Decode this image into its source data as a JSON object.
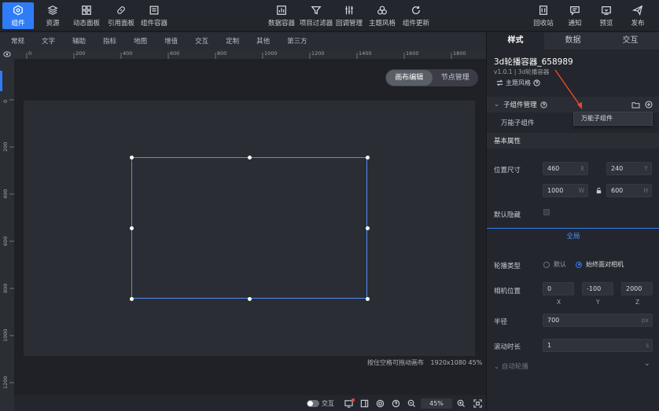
{
  "toolbar": {
    "left": [
      {
        "label": "组件",
        "icon": "component-icon"
      },
      {
        "label": "资源",
        "icon": "layers-icon"
      },
      {
        "label": "动态面板",
        "icon": "panel-icon"
      },
      {
        "label": "引用面板",
        "icon": "link-icon"
      },
      {
        "label": "组件容器",
        "icon": "container-icon"
      }
    ],
    "center": [
      {
        "label": "数据容器",
        "icon": "chart-icon"
      },
      {
        "label": "项目过滤器",
        "icon": "filter-icon"
      },
      {
        "label": "回调管理",
        "icon": "sliders-icon"
      },
      {
        "label": "主题风格",
        "icon": "theme-icon"
      },
      {
        "label": "组件更新",
        "icon": "refresh-icon"
      }
    ],
    "right": [
      {
        "label": "回收站",
        "icon": "trash-icon"
      },
      {
        "label": "通知",
        "icon": "message-icon"
      },
      {
        "label": "预览",
        "icon": "preview-icon"
      },
      {
        "label": "发布",
        "icon": "send-icon"
      }
    ]
  },
  "categories": [
    "常规",
    "文字",
    "辅助",
    "指标",
    "地图",
    "增值",
    "交互",
    "定制",
    "其他",
    "第三方"
  ],
  "ruler": {
    "top": [
      "0",
      "200",
      "400",
      "600",
      "800",
      "1000",
      "1200",
      "1400",
      "1600",
      "1800"
    ],
    "left": [
      "0",
      "200",
      "400",
      "600",
      "800",
      "1000",
      "1200"
    ]
  },
  "canvas": {
    "mode_tabs": [
      "画布编辑",
      "节点管理"
    ],
    "active_mode": "画布编辑",
    "hint": "按住空格可拖动画布",
    "resolution": "1920x1080 45%"
  },
  "bottombar": {
    "interaction_label": "交互",
    "zoom": "45%"
  },
  "panel": {
    "tabs": [
      "样式",
      "数据",
      "交互"
    ],
    "active_tab": "样式",
    "title": "3d轮播容器_658989",
    "subtitle": "v1.0.1 | 3d轮播容器",
    "theme_label": "主题风格",
    "child_section": "子组件管理",
    "child_item": "万能子组件",
    "dropdown_item": "万能子组件",
    "basic_section": "基本属性",
    "position_label": "位置尺寸",
    "pos": {
      "x": "460",
      "y": "240",
      "w": "1000",
      "h": "600",
      "x_suf": "X",
      "y_suf": "Y",
      "w_suf": "W",
      "h_suf": "H"
    },
    "hidden_label": "默认隐藏",
    "global_label": "全局",
    "carousel_label": "轮播类型",
    "carousel_options": [
      "默认",
      "始终面对相机"
    ],
    "carousel_selected": "始终面对相机",
    "camera_label": "相机位置",
    "camera": {
      "x": "0",
      "y": "-100",
      "z": "2000",
      "x_lbl": "X",
      "y_lbl": "Y",
      "z_lbl": "Z"
    },
    "radius_label": "半径",
    "radius": {
      "value": "700",
      "unit": "px"
    },
    "scroll_label": "滚动时长",
    "scroll": {
      "value": "1",
      "unit": "s"
    },
    "autoplay_label": "自动轮播"
  },
  "colors": {
    "accent": "#2f7df6",
    "annotation_arrow": "#e8492f"
  }
}
